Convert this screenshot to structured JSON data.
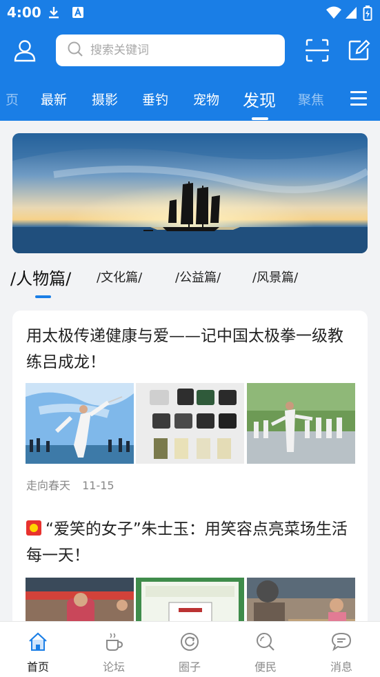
{
  "statusbar": {
    "time": "4:00"
  },
  "search": {
    "placeholder": "搜索关键词"
  },
  "tabs": [
    {
      "label": "页",
      "state": "faded"
    },
    {
      "label": "最新"
    },
    {
      "label": "摄影"
    },
    {
      "label": "垂钓"
    },
    {
      "label": "宠物"
    },
    {
      "label": "发现",
      "state": "active"
    },
    {
      "label": "聚焦",
      "state": "faded"
    }
  ],
  "subtabs": [
    {
      "label": "/人物篇/",
      "state": "active"
    },
    {
      "label": "/文化篇/"
    },
    {
      "label": "/公益篇/"
    },
    {
      "label": "/风景篇/"
    }
  ],
  "articles": [
    {
      "title": "用太极传递健康与爱——记中国太极拳一级教练吕成龙！",
      "author": "走向春天",
      "date": "11-15"
    },
    {
      "title": "“爱笑的女子”朱士玉：用笑容点亮菜场生活每一天！"
    }
  ],
  "bottomnav": [
    {
      "label": "首页",
      "icon": "home-icon",
      "active": true
    },
    {
      "label": "论坛",
      "icon": "coffee-cup-icon"
    },
    {
      "label": "圈子",
      "icon": "refresh-circle-icon"
    },
    {
      "label": "便民",
      "icon": "search-icon"
    },
    {
      "label": "消息",
      "icon": "chat-bubble-icon"
    }
  ],
  "colors": {
    "brand": "#1a7ee6",
    "background": "#f2f3f5",
    "flag_red": "#e8322e"
  }
}
